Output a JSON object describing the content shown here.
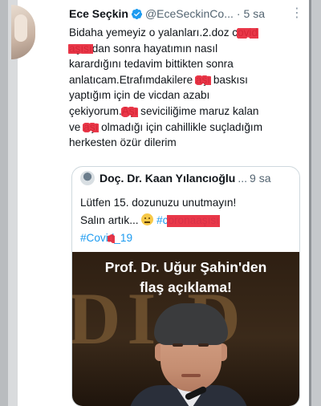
{
  "tweet": {
    "author_name": "Ece Seçkin",
    "handle": "@EceSeckinCo...",
    "separator": "·",
    "time": "5 sa",
    "lines": [
      "Bidaha yemeyiz o yalanları.2.doz c",
      "ol",
      "dan sonra hayatımın nasıl",
      "karardığını tedavim bittikten sonra",
      "anlatıcam.Etrafımdakilere",
      "baskısı",
      "yaptığım için de vicdan azabı",
      "çekiyorum.",
      "seviciliğime maruz kalan",
      "ve",
      "olmadığı için cahillikle suçladığım",
      "herkesten özür dilerim"
    ]
  },
  "quote": {
    "author_name": "Doç. Dr. Kaan Yılancıoğlu",
    "separator": "...",
    "time": "9 sa",
    "line1": "Lütfen 15. dozunuzu unutmayın!",
    "line2_start": "Salın artık...",
    "hashtag1": "#c",
    "hashtag2": "#Covi",
    "hashtag2_end": "_19",
    "image": {
      "headline_line1": "Prof. Dr. Uğur Şahin'den",
      "headline_line2": "flaş açıklama!",
      "background_letters": "DI D"
    }
  },
  "colors": {
    "link": "#1d9bf0",
    "verified": "#1d9bf0",
    "redaction": "#e8283a"
  },
  "icons": {
    "verified": "verified-badge-icon",
    "more": "more-options-icon",
    "emoji": "neutral-face-emoji-icon"
  }
}
